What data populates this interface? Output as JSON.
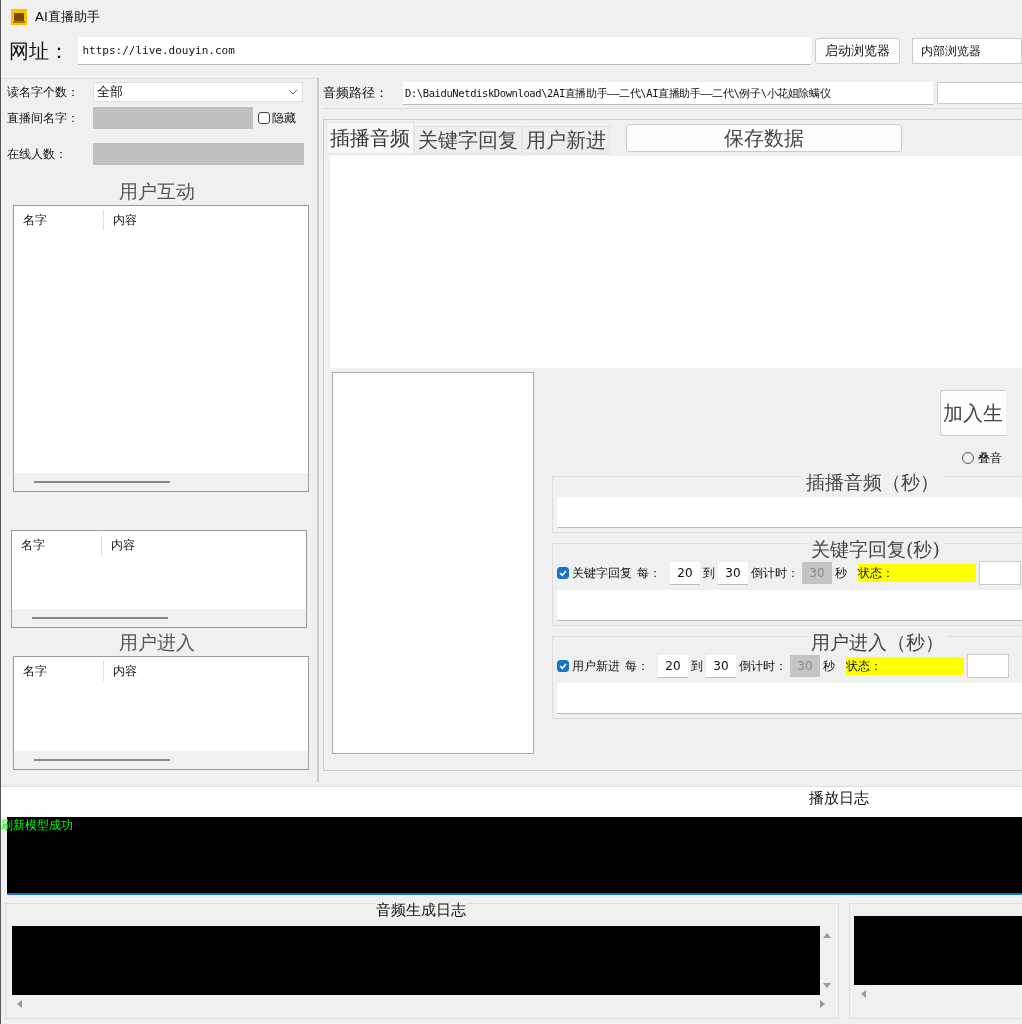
{
  "window": {
    "title": "AI直播助手"
  },
  "url_bar": {
    "label": "网址：",
    "value": "https://live.douyin.com",
    "launch_button": "启动浏览器",
    "browser_select": "内部浏览器"
  },
  "left_panel": {
    "name_count": {
      "label": "读名字个数：",
      "value": "全部"
    },
    "room_name": {
      "label": "直播间名字："
    },
    "hide_checkbox": {
      "label": "隐藏",
      "checked": false
    },
    "online_count": {
      "label": "在线人数："
    },
    "lists": [
      {
        "title": "用户互动",
        "columns": [
          "名字",
          "内容"
        ]
      },
      {
        "columns": [
          "名字",
          "内容"
        ]
      },
      {
        "title": "用户进入",
        "columns": [
          "名字",
          "内容"
        ]
      }
    ]
  },
  "right_panel": {
    "audio_path": {
      "label": "音频路径：",
      "value": "D:\\BaiduNetdiskDownload\\2AI直播助手——二代\\AI直播助手——二代\\例子\\小花姐除螨仪"
    },
    "tabs": [
      {
        "label": "插播音频",
        "selected": true
      },
      {
        "label": "关键字回复",
        "selected": false
      },
      {
        "label": "用户新进",
        "selected": false
      }
    ],
    "save_button": "保存数据",
    "add_button": "加入生",
    "radio": {
      "label": "叠音",
      "selected": false
    },
    "groups": [
      {
        "kind": "plain",
        "title": "插播音频（秒）"
      },
      {
        "kind": "timer",
        "title": "关键字回复(秒)",
        "checkbox": {
          "label": "关键字回复",
          "checked": true
        },
        "every_label": "每：",
        "from": "20",
        "to_label": "到",
        "to": "30",
        "countdown_label": "倒计时：",
        "countdown": "30",
        "countdown_disabled": true,
        "unit": "秒",
        "status_label": "状态："
      },
      {
        "kind": "timer",
        "title": "用户进入（秒）",
        "checkbox": {
          "label": "用户新进",
          "checked": true
        },
        "every_label": "每：",
        "from": "20",
        "to_label": "到",
        "to": "30",
        "countdown_label": "倒计时：",
        "countdown": "30",
        "countdown_disabled": true,
        "unit": "秒",
        "status_label": "状态："
      }
    ]
  },
  "play_log": {
    "title": "播放日志",
    "lines": [
      "刷新模型成功"
    ]
  },
  "audio_log": {
    "title": "音频生成日志"
  }
}
